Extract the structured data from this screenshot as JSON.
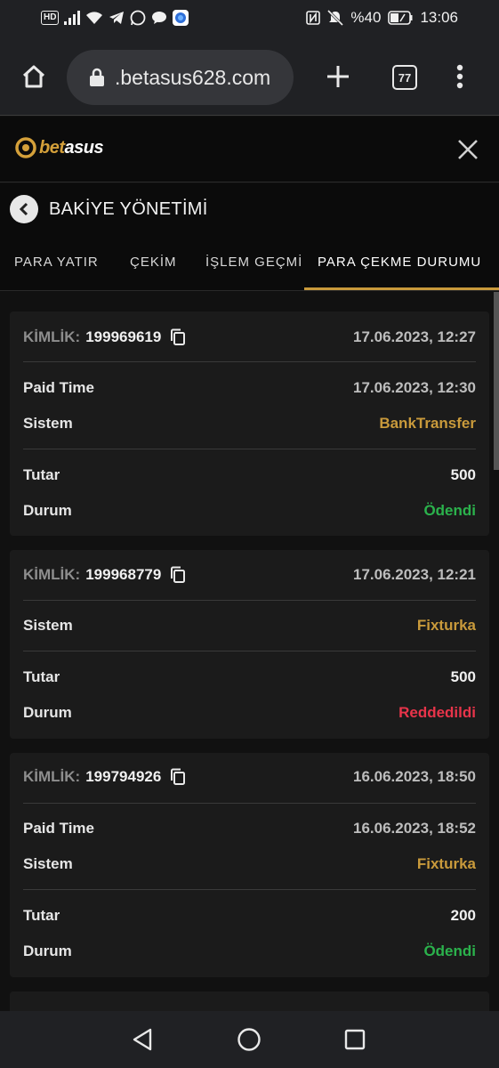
{
  "status_bar": {
    "battery_text": "%40",
    "time": "13:06",
    "hd_badge": "HD",
    "icons": [
      "hd-icon",
      "signal-icon",
      "wifi-icon",
      "telegram-icon",
      "whatsapp-icon",
      "chat-icon",
      "browser-icon",
      "nfc-icon",
      "mute-icon",
      "battery-icon"
    ]
  },
  "browser": {
    "url": ".betasus628.com",
    "tab_count": "77"
  },
  "site": {
    "logo_prefix": "bet",
    "logo_suffix": "asus"
  },
  "page": {
    "title": "BAKİYE YÖNETİMİ"
  },
  "tabs": [
    {
      "label": "PARA YATIR",
      "active": false
    },
    {
      "label": "ÇEKİM",
      "active": false
    },
    {
      "label": "İŞLEM GEÇMİ",
      "active": false
    },
    {
      "label": "PARA ÇEKME DURUMU",
      "active": true
    }
  ],
  "labels": {
    "id": "KİMLİK:",
    "paid_time": "Paid Time",
    "system": "Sistem",
    "amount": "Tutar",
    "status": "Durum"
  },
  "withdrawals": [
    {
      "id": "199969619",
      "created": "17.06.2023, 12:27",
      "paid_time": "17.06.2023, 12:30",
      "system": "BankTransfer",
      "amount": "500",
      "status": "Ödendi"
    },
    {
      "id": "199968779",
      "created": "17.06.2023, 12:21",
      "system": "Fixturka",
      "amount": "500",
      "status": "Reddedildi"
    },
    {
      "id": "199794926",
      "created": "16.06.2023, 18:50",
      "paid_time": "16.06.2023, 18:52",
      "system": "Fixturka",
      "amount": "200",
      "status": "Ödendi"
    }
  ],
  "colors": {
    "accent_gold": "#c99a3b",
    "status_paid": "#2bb24c",
    "status_rejected": "#e8344a"
  }
}
